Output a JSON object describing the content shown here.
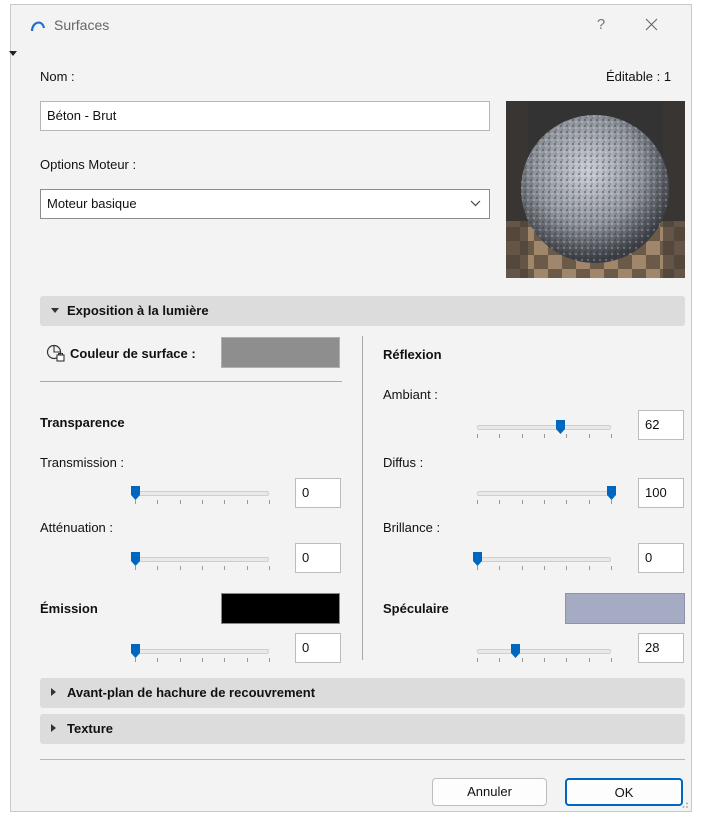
{
  "window": {
    "title": "Surfaces",
    "help": "?"
  },
  "name": {
    "label": "Nom :",
    "value": "Béton - Brut",
    "editable": "Éditable : 1"
  },
  "engine": {
    "label": "Options Moteur :",
    "selected": "Moteur basique"
  },
  "sections": {
    "light": "Exposition à la lumière",
    "overlay": "Avant-plan de hachure de recouvrement",
    "texture": "Texture"
  },
  "surface_color": {
    "label": "Couleur de surface :",
    "color": "#8e8e8e"
  },
  "transparency": {
    "title": "Transparence",
    "transmission": {
      "label": "Transmission :",
      "value": "0",
      "level": 0
    },
    "attenuation": {
      "label": "Atténuation :",
      "value": "0",
      "level": 0
    }
  },
  "emission": {
    "label": "Émission",
    "color": "#000000",
    "value": "0",
    "level": 0
  },
  "reflection": {
    "title": "Réflexion",
    "ambient": {
      "label": "Ambiant :",
      "value": "62",
      "level": 62
    },
    "diffuse": {
      "label": "Diffus :",
      "value": "100",
      "level": 100
    },
    "shininess": {
      "label": "Brillance :",
      "value": "0",
      "level": 0
    }
  },
  "specular": {
    "label": "Spéculaire",
    "color": "#a4abc3",
    "value": "28",
    "level": 28
  },
  "buttons": {
    "cancel": "Annuler",
    "ok": "OK"
  },
  "colors": {
    "accent": "#0067c0",
    "section_bg": "#dcdcdc"
  }
}
